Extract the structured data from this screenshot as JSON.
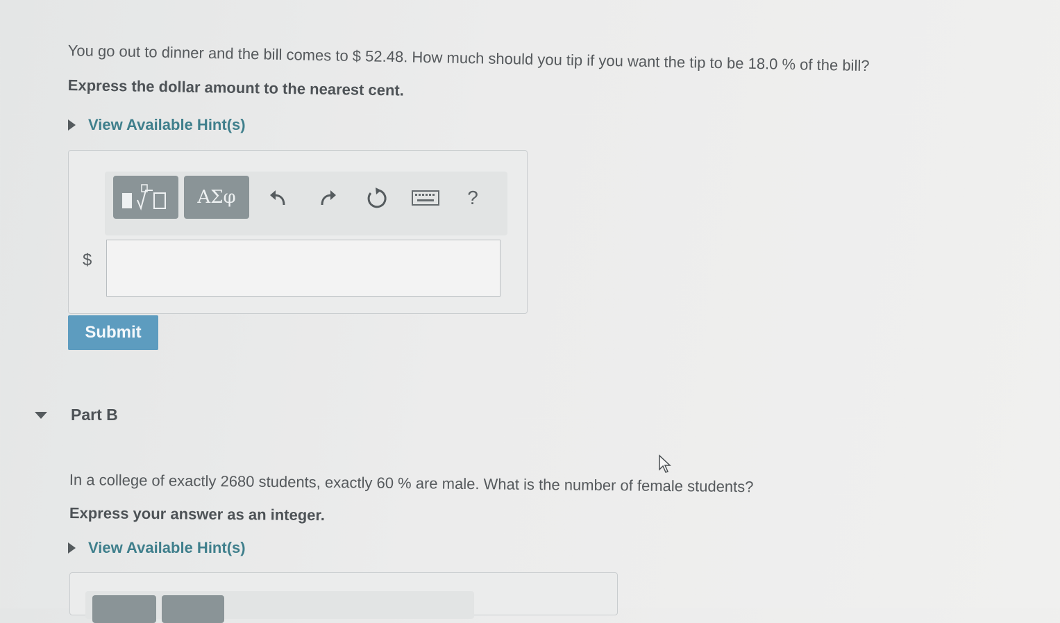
{
  "partA": {
    "question": "You go out to dinner and the bill comes to $ 52.48. How much should you tip if you want the tip to be 18.0 % of the bill?",
    "instruction": "Express the dollar amount to the nearest cent.",
    "hint_label": "View Available Hint(s)",
    "toolbar": {
      "templates_icon": "fraction-radical-template-icon",
      "greek_label": "ΑΣφ",
      "undo_icon": "undo-arrow-icon",
      "redo_icon": "redo-arrow-icon",
      "reset_icon": "reset-circle-icon",
      "keyboard_icon": "keyboard-icon",
      "help_label": "?"
    },
    "currency_symbol": "$",
    "answer_value": "",
    "submit_label": "Submit"
  },
  "partB": {
    "title": "Part B",
    "question": "In a college of exactly 2680 students, exactly 60 % are male.  What is the number of female students?",
    "instruction": "Express your answer as an integer.",
    "hint_label": "View Available Hint(s)"
  },
  "colors": {
    "hint_link": "#3f7f8c",
    "submit_button": "#5d9cbf",
    "toolbar_button": "#8a9497"
  }
}
